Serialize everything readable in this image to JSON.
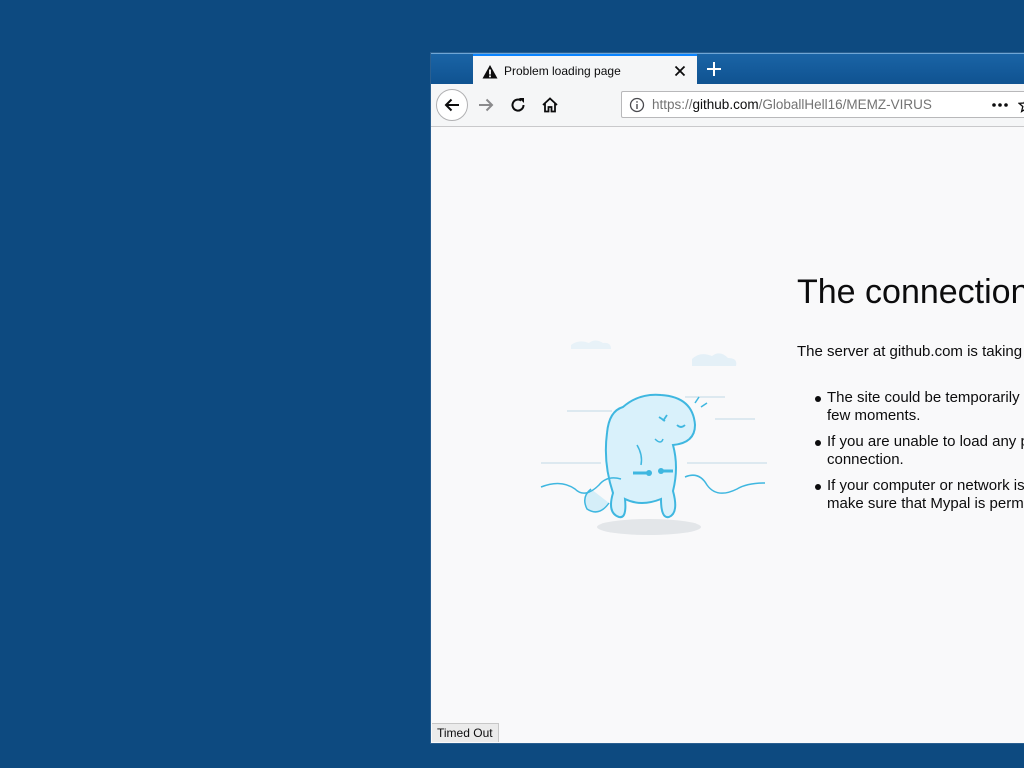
{
  "tab": {
    "title": "Problem loading page"
  },
  "urlbar": {
    "protocol": "https://",
    "host": "github.com",
    "path": "/GloballHell16/MEMZ-VIRUS"
  },
  "error": {
    "heading": "The connection",
    "description": "The server at github.com is taking t",
    "tips": [
      {
        "line1": "The site could be temporarily u",
        "line2": "few moments."
      },
      {
        "line1": "If you are unable to load any pa",
        "line2": "connection."
      },
      {
        "line1": "If your computer or network is",
        "line2": "make sure that Mypal is permi"
      }
    ]
  },
  "statusbar": {
    "text": "Timed Out"
  },
  "icons": [
    "warning-icon",
    "close-icon",
    "plus-icon",
    "back-arrow-icon",
    "forward-arrow-icon",
    "reload-icon",
    "home-icon",
    "info-icon",
    "more-icon",
    "star-icon"
  ],
  "colors": {
    "desktop": "#0d4a80",
    "tab_accent": "#0a84ff",
    "illustration": "#3fb7e0"
  }
}
